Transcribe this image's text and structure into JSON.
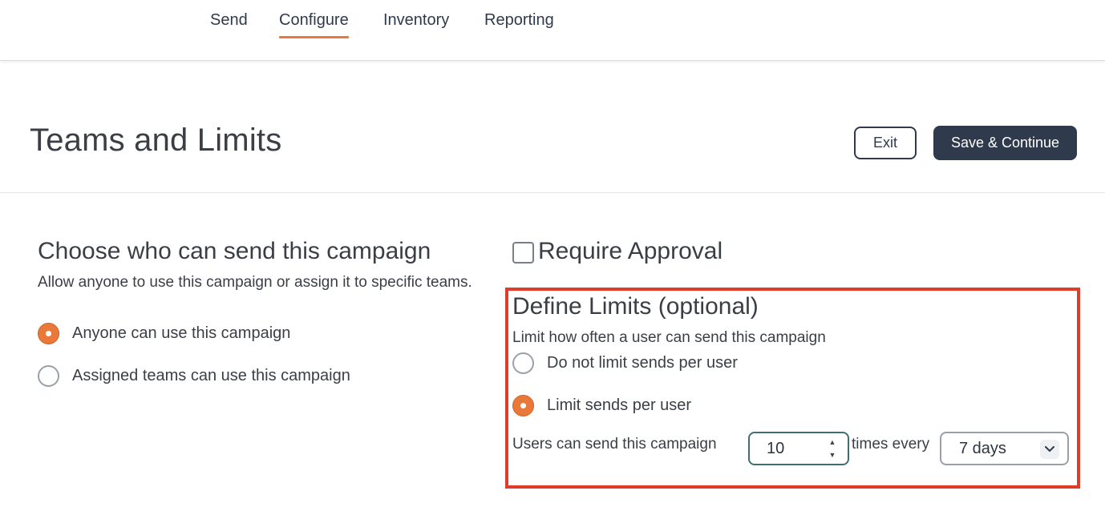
{
  "nav": {
    "tabs": [
      {
        "label": "Send"
      },
      {
        "label": "Configure",
        "active": true
      },
      {
        "label": "Inventory"
      },
      {
        "label": "Reporting"
      }
    ]
  },
  "header": {
    "title": "Teams and Limits",
    "exit_label": "Exit",
    "save_label": "Save & Continue"
  },
  "access": {
    "title": "Choose who can send this campaign",
    "description": "Allow anyone to use this campaign or assign it to specific teams.",
    "options": [
      {
        "label": "Anyone can use this campaign",
        "selected": true
      },
      {
        "label": "Assigned teams can use this campaign",
        "selected": false
      }
    ]
  },
  "approval": {
    "label": "Require Approval",
    "checked": false
  },
  "limits": {
    "title": "Define Limits (optional)",
    "description": "Limit how often a user can send this campaign",
    "options": [
      {
        "label": "Do not limit sends per user",
        "selected": false
      },
      {
        "label": "Limit sends per user",
        "selected": true
      }
    ],
    "prefix": "Users can send this campaign",
    "count_value": "10",
    "middle": "times every",
    "period_value": "7 days"
  },
  "colors": {
    "accent": "#e8793a",
    "primary_button": "#2f3a4c",
    "highlight_box": "#e03c2a",
    "input_focus_border": "#3f6f73"
  }
}
